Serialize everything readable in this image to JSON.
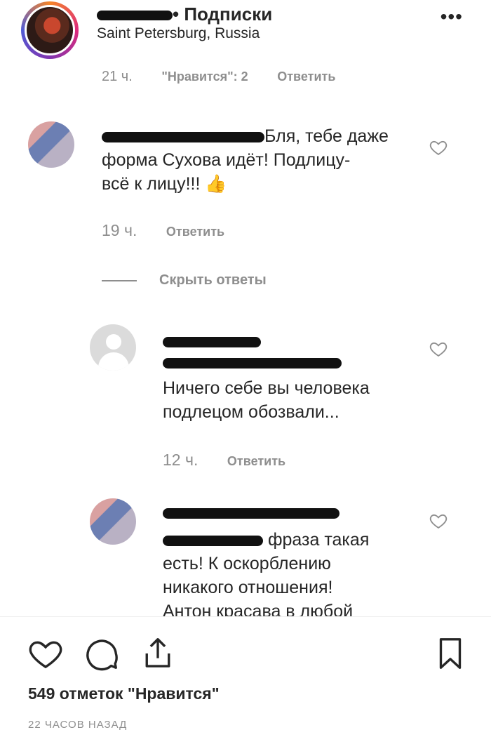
{
  "header": {
    "follow_label": "• Подписки",
    "location": "Saint Petersburg, Russia",
    "more_icon": "more-horizontal-icon"
  },
  "top_meta": {
    "time": "21 ч.",
    "likes": "\"Нравится\": 2",
    "reply": "Ответить"
  },
  "comments": [
    {
      "text_line1": "Бля, тебе даже",
      "text_line2": "форма Сухова идёт! Подлицу-",
      "text_line3": "всё к лицу!!!",
      "emoji": "👍",
      "time": "19 ч.",
      "reply": "Ответить"
    }
  ],
  "hide_replies": "Скрыть ответы",
  "replies": [
    {
      "text_line1": "Ничего себе вы человека",
      "text_line2": "подлецом обозвали...",
      "time": "12 ч.",
      "reply": "Ответить"
    },
    {
      "text_line1": "фраза такая",
      "text_line2": "есть! К оскорблению",
      "text_line3": "никакого отношения!",
      "text_line4": "Антон красава в любой"
    }
  ],
  "footer": {
    "likes_count": "549 отметок \"Нравится\"",
    "time_ago": "22 ЧАСОВ НАЗАД"
  }
}
